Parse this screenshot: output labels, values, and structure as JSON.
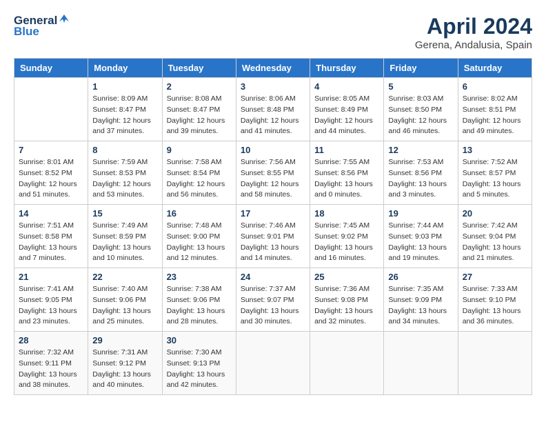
{
  "header": {
    "logo_general": "General",
    "logo_blue": "Blue",
    "title": "April 2024",
    "subtitle": "Gerena, Andalusia, Spain"
  },
  "calendar": {
    "days_of_week": [
      "Sunday",
      "Monday",
      "Tuesday",
      "Wednesday",
      "Thursday",
      "Friday",
      "Saturday"
    ],
    "weeks": [
      [
        {
          "day": "",
          "info": ""
        },
        {
          "day": "1",
          "info": "Sunrise: 8:09 AM\nSunset: 8:47 PM\nDaylight: 12 hours\nand 37 minutes."
        },
        {
          "day": "2",
          "info": "Sunrise: 8:08 AM\nSunset: 8:47 PM\nDaylight: 12 hours\nand 39 minutes."
        },
        {
          "day": "3",
          "info": "Sunrise: 8:06 AM\nSunset: 8:48 PM\nDaylight: 12 hours\nand 41 minutes."
        },
        {
          "day": "4",
          "info": "Sunrise: 8:05 AM\nSunset: 8:49 PM\nDaylight: 12 hours\nand 44 minutes."
        },
        {
          "day": "5",
          "info": "Sunrise: 8:03 AM\nSunset: 8:50 PM\nDaylight: 12 hours\nand 46 minutes."
        },
        {
          "day": "6",
          "info": "Sunrise: 8:02 AM\nSunset: 8:51 PM\nDaylight: 12 hours\nand 49 minutes."
        }
      ],
      [
        {
          "day": "7",
          "info": "Sunrise: 8:01 AM\nSunset: 8:52 PM\nDaylight: 12 hours\nand 51 minutes."
        },
        {
          "day": "8",
          "info": "Sunrise: 7:59 AM\nSunset: 8:53 PM\nDaylight: 12 hours\nand 53 minutes."
        },
        {
          "day": "9",
          "info": "Sunrise: 7:58 AM\nSunset: 8:54 PM\nDaylight: 12 hours\nand 56 minutes."
        },
        {
          "day": "10",
          "info": "Sunrise: 7:56 AM\nSunset: 8:55 PM\nDaylight: 12 hours\nand 58 minutes."
        },
        {
          "day": "11",
          "info": "Sunrise: 7:55 AM\nSunset: 8:56 PM\nDaylight: 13 hours\nand 0 minutes."
        },
        {
          "day": "12",
          "info": "Sunrise: 7:53 AM\nSunset: 8:56 PM\nDaylight: 13 hours\nand 3 minutes."
        },
        {
          "day": "13",
          "info": "Sunrise: 7:52 AM\nSunset: 8:57 PM\nDaylight: 13 hours\nand 5 minutes."
        }
      ],
      [
        {
          "day": "14",
          "info": "Sunrise: 7:51 AM\nSunset: 8:58 PM\nDaylight: 13 hours\nand 7 minutes."
        },
        {
          "day": "15",
          "info": "Sunrise: 7:49 AM\nSunset: 8:59 PM\nDaylight: 13 hours\nand 10 minutes."
        },
        {
          "day": "16",
          "info": "Sunrise: 7:48 AM\nSunset: 9:00 PM\nDaylight: 13 hours\nand 12 minutes."
        },
        {
          "day": "17",
          "info": "Sunrise: 7:46 AM\nSunset: 9:01 PM\nDaylight: 13 hours\nand 14 minutes."
        },
        {
          "day": "18",
          "info": "Sunrise: 7:45 AM\nSunset: 9:02 PM\nDaylight: 13 hours\nand 16 minutes."
        },
        {
          "day": "19",
          "info": "Sunrise: 7:44 AM\nSunset: 9:03 PM\nDaylight: 13 hours\nand 19 minutes."
        },
        {
          "day": "20",
          "info": "Sunrise: 7:42 AM\nSunset: 9:04 PM\nDaylight: 13 hours\nand 21 minutes."
        }
      ],
      [
        {
          "day": "21",
          "info": "Sunrise: 7:41 AM\nSunset: 9:05 PM\nDaylight: 13 hours\nand 23 minutes."
        },
        {
          "day": "22",
          "info": "Sunrise: 7:40 AM\nSunset: 9:06 PM\nDaylight: 13 hours\nand 25 minutes."
        },
        {
          "day": "23",
          "info": "Sunrise: 7:38 AM\nSunset: 9:06 PM\nDaylight: 13 hours\nand 28 minutes."
        },
        {
          "day": "24",
          "info": "Sunrise: 7:37 AM\nSunset: 9:07 PM\nDaylight: 13 hours\nand 30 minutes."
        },
        {
          "day": "25",
          "info": "Sunrise: 7:36 AM\nSunset: 9:08 PM\nDaylight: 13 hours\nand 32 minutes."
        },
        {
          "day": "26",
          "info": "Sunrise: 7:35 AM\nSunset: 9:09 PM\nDaylight: 13 hours\nand 34 minutes."
        },
        {
          "day": "27",
          "info": "Sunrise: 7:33 AM\nSunset: 9:10 PM\nDaylight: 13 hours\nand 36 minutes."
        }
      ],
      [
        {
          "day": "28",
          "info": "Sunrise: 7:32 AM\nSunset: 9:11 PM\nDaylight: 13 hours\nand 38 minutes."
        },
        {
          "day": "29",
          "info": "Sunrise: 7:31 AM\nSunset: 9:12 PM\nDaylight: 13 hours\nand 40 minutes."
        },
        {
          "day": "30",
          "info": "Sunrise: 7:30 AM\nSunset: 9:13 PM\nDaylight: 13 hours\nand 42 minutes."
        },
        {
          "day": "",
          "info": ""
        },
        {
          "day": "",
          "info": ""
        },
        {
          "day": "",
          "info": ""
        },
        {
          "day": "",
          "info": ""
        }
      ]
    ]
  }
}
